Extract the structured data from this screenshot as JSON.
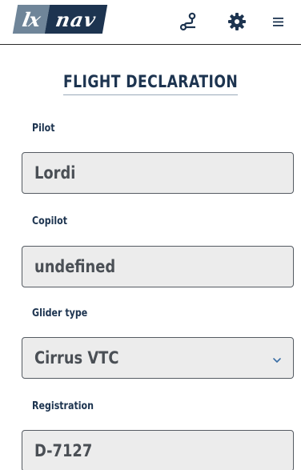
{
  "header": {
    "logo_left": "lx",
    "logo_right": "nav",
    "icons": [
      "route-icon",
      "gear-icon",
      "hamburger-menu-icon"
    ]
  },
  "page_title": "FLIGHT DECLARATION",
  "form": {
    "pilot": {
      "label": "Pilot",
      "value": "Lordi"
    },
    "copilot": {
      "label": "Copilot",
      "value": "undefined"
    },
    "glider_type": {
      "label": "Glider type",
      "value": "Cirrus VTC"
    },
    "registration": {
      "label": "Registration",
      "value": "D-7127"
    }
  },
  "colors": {
    "brand_dark": "#1d3450",
    "brand_light": "#6f8599",
    "field_bg": "#ececec",
    "field_border": "#555b62"
  }
}
